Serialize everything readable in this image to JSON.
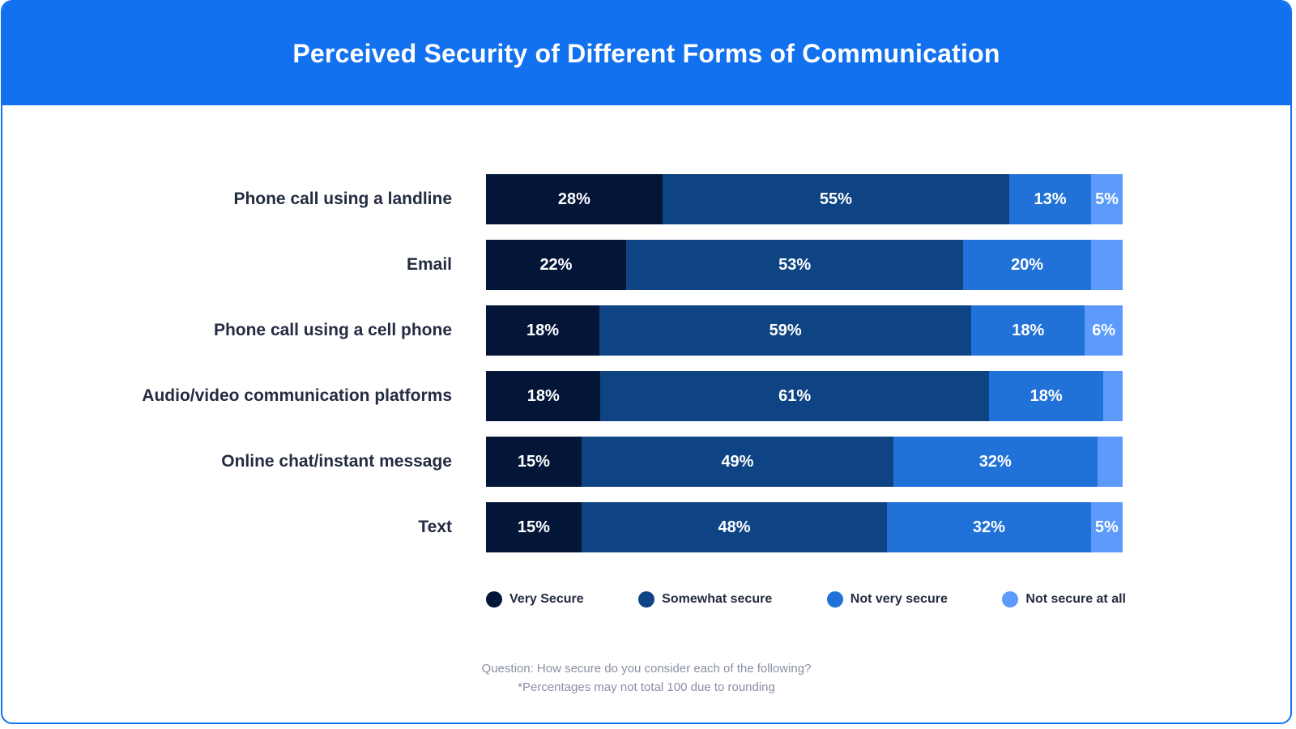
{
  "header": {
    "title": "Perceived Security of Different Forms of Communication",
    "background_color": "#1271ef",
    "title_color": "#ffffff"
  },
  "card": {
    "border_color": "#1271ef",
    "background_color": "#ffffff"
  },
  "footnote": {
    "line1": "Question: How secure do you consider each of the following?",
    "line2": "*Percentages may not total 100 due to rounding",
    "color": "#8a8fa3"
  },
  "chart_data": {
    "type": "bar",
    "orientation": "horizontal",
    "stacked": true,
    "stack_total": 100,
    "units": "percent",
    "title": "Perceived Security of Different Forms of Communication",
    "subtitle": "",
    "xlabel": "",
    "ylabel": "",
    "xlim": [
      0,
      100
    ],
    "grid": false,
    "legend_position": "bottom",
    "value_label_suffix": "%",
    "categories": [
      "Phone call using a landline",
      "Email",
      "Phone call using a cell phone",
      "Audio/video communication platforms",
      "Online chat/instant message",
      "Text"
    ],
    "series": [
      {
        "name": "Very Secure",
        "color": "#041638",
        "values": [
          28,
          22,
          18,
          18,
          15,
          15
        ],
        "labels": [
          "28%",
          "22%",
          "18%",
          "18%",
          "15%",
          "15%"
        ]
      },
      {
        "name": "Somewhat secure",
        "color": "#0e4483",
        "values": [
          55,
          53,
          59,
          61,
          49,
          48
        ],
        "labels": [
          "55%",
          "53%",
          "59%",
          "61%",
          "49%",
          "48%"
        ]
      },
      {
        "name": "Not very secure",
        "color": "#2172d8",
        "values": [
          13,
          20,
          18,
          18,
          32,
          32
        ],
        "labels": [
          "13%",
          "20%",
          "18%",
          "18%",
          "32%",
          "32%"
        ]
      },
      {
        "name": "Not secure at all",
        "color": "#5c9bfb",
        "values": [
          5,
          5,
          6,
          3,
          4,
          5
        ],
        "labels": [
          "5%",
          "",
          "6%",
          "",
          "",
          "5%"
        ]
      }
    ],
    "legend": [
      {
        "label": "Very Secure",
        "color": "#041638"
      },
      {
        "label": "Somewhat secure",
        "color": "#0e4483"
      },
      {
        "label": "Not very secure",
        "color": "#2172d8"
      },
      {
        "label": "Not secure at all",
        "color": "#5c9bfb"
      }
    ]
  }
}
